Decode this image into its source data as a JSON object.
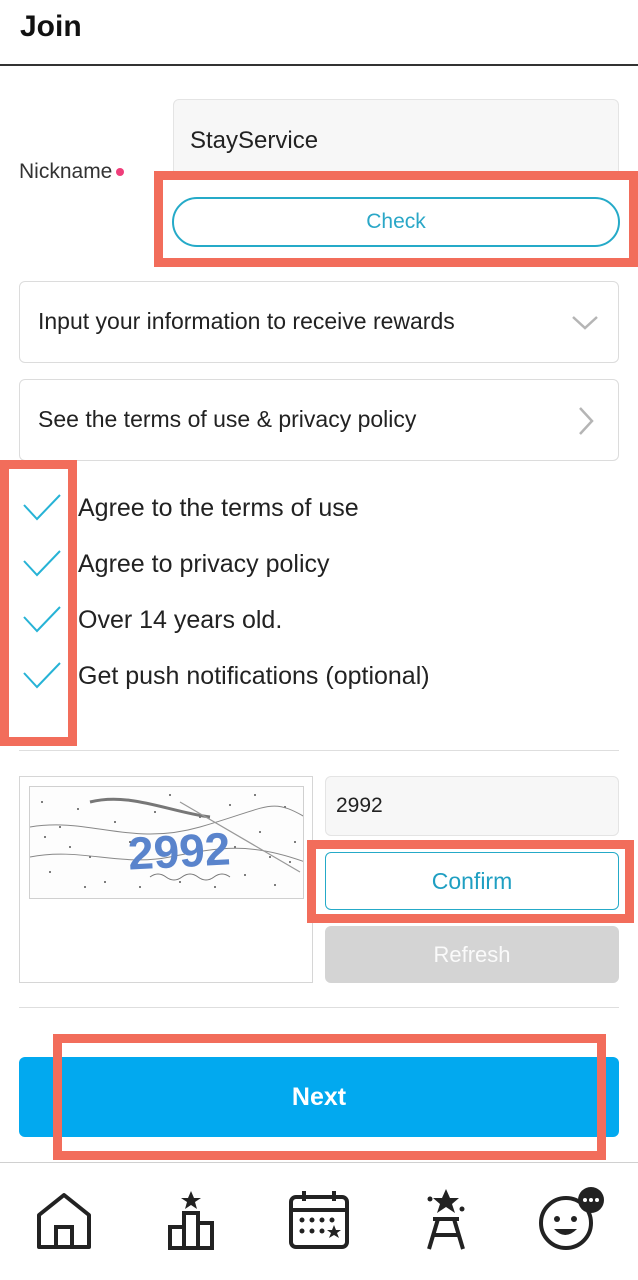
{
  "header": {
    "title": "Join"
  },
  "nickname": {
    "label": "Nickname",
    "value": "StayService",
    "check_label": "Check"
  },
  "rows": {
    "info_label": "Input your information to receive rewards",
    "terms_label": "See the terms of use & privacy policy"
  },
  "agreements": [
    {
      "label": "Agree to the terms of use",
      "checked": true
    },
    {
      "label": "Agree to privacy policy",
      "checked": true
    },
    {
      "label": "Over 14 years old.",
      "checked": true
    },
    {
      "label": "Get push notifications (optional)",
      "checked": true
    }
  ],
  "captcha": {
    "image_text": "2992",
    "input_value": "2992",
    "confirm_label": "Confirm",
    "refresh_label": "Refresh"
  },
  "next_label": "Next",
  "bottom_nav": [
    "home-icon",
    "ranking-icon",
    "calendar-icon",
    "stage-icon",
    "chat-emoji-icon"
  ],
  "colors": {
    "accent": "#02a9ef",
    "teal": "#25aac8",
    "required_dot": "#ef3e7a",
    "highlight": "#f26d5b",
    "disabled": "#d4d4d4"
  }
}
